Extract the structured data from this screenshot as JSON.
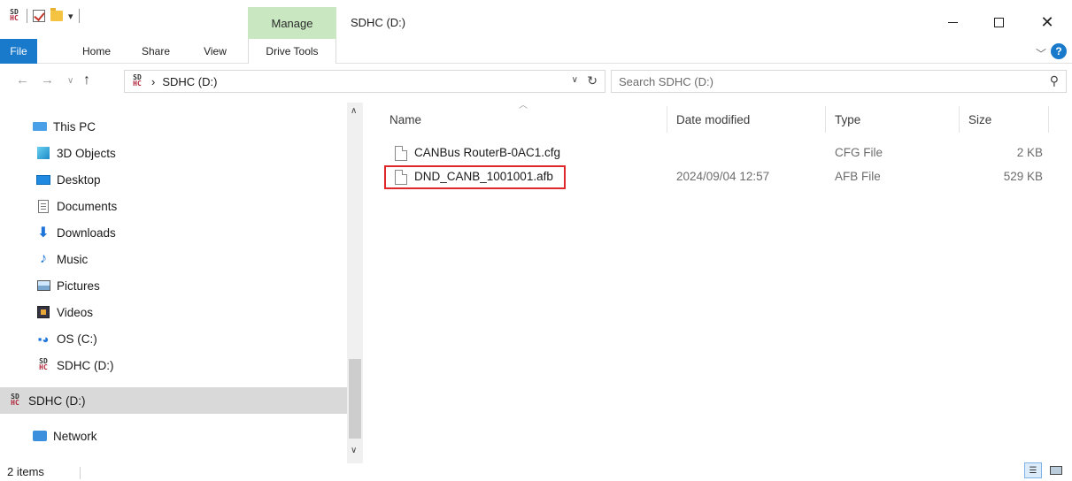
{
  "window": {
    "title": "SDHC (D:)",
    "manage_label": "Manage"
  },
  "ribbon": {
    "tabs": [
      "File",
      "Home",
      "Share",
      "View",
      "Drive Tools"
    ]
  },
  "address": {
    "path": "SDHC (D:)",
    "search_placeholder": "Search SDHC (D:)"
  },
  "sidebar": {
    "items": [
      {
        "label": "This PC",
        "icon": "pc-icon"
      },
      {
        "label": "3D Objects",
        "icon": "3d-objects-icon"
      },
      {
        "label": "Desktop",
        "icon": "desktop-icon"
      },
      {
        "label": "Documents",
        "icon": "documents-icon"
      },
      {
        "label": "Downloads",
        "icon": "downloads-icon"
      },
      {
        "label": "Music",
        "icon": "music-icon"
      },
      {
        "label": "Pictures",
        "icon": "pictures-icon"
      },
      {
        "label": "Videos",
        "icon": "videos-icon"
      },
      {
        "label": "OS (C:)",
        "icon": "os-drive-icon"
      },
      {
        "label": "SDHC (D:)",
        "icon": "sdhc-icon"
      },
      {
        "label": "SDHC (D:)",
        "icon": "sdhc-icon"
      },
      {
        "label": "Network",
        "icon": "network-icon"
      }
    ]
  },
  "columns": {
    "name": "Name",
    "date": "Date modified",
    "type": "Type",
    "size": "Size"
  },
  "files": [
    {
      "name": "CANBus RouterB-0AC1.cfg",
      "date": "",
      "type": "CFG File",
      "size": "2 KB"
    },
    {
      "name": "DND_CANB_1001001.afb",
      "date": "2024/09/04 12:57",
      "type": "AFB File",
      "size": "529 KB"
    }
  ],
  "status": {
    "item_count": "2 items"
  },
  "colors": {
    "accent": "#1979ca",
    "manage_tab": "#c9e7c0",
    "highlight": "#e0282c",
    "selected_row": "#d9d9d9"
  }
}
